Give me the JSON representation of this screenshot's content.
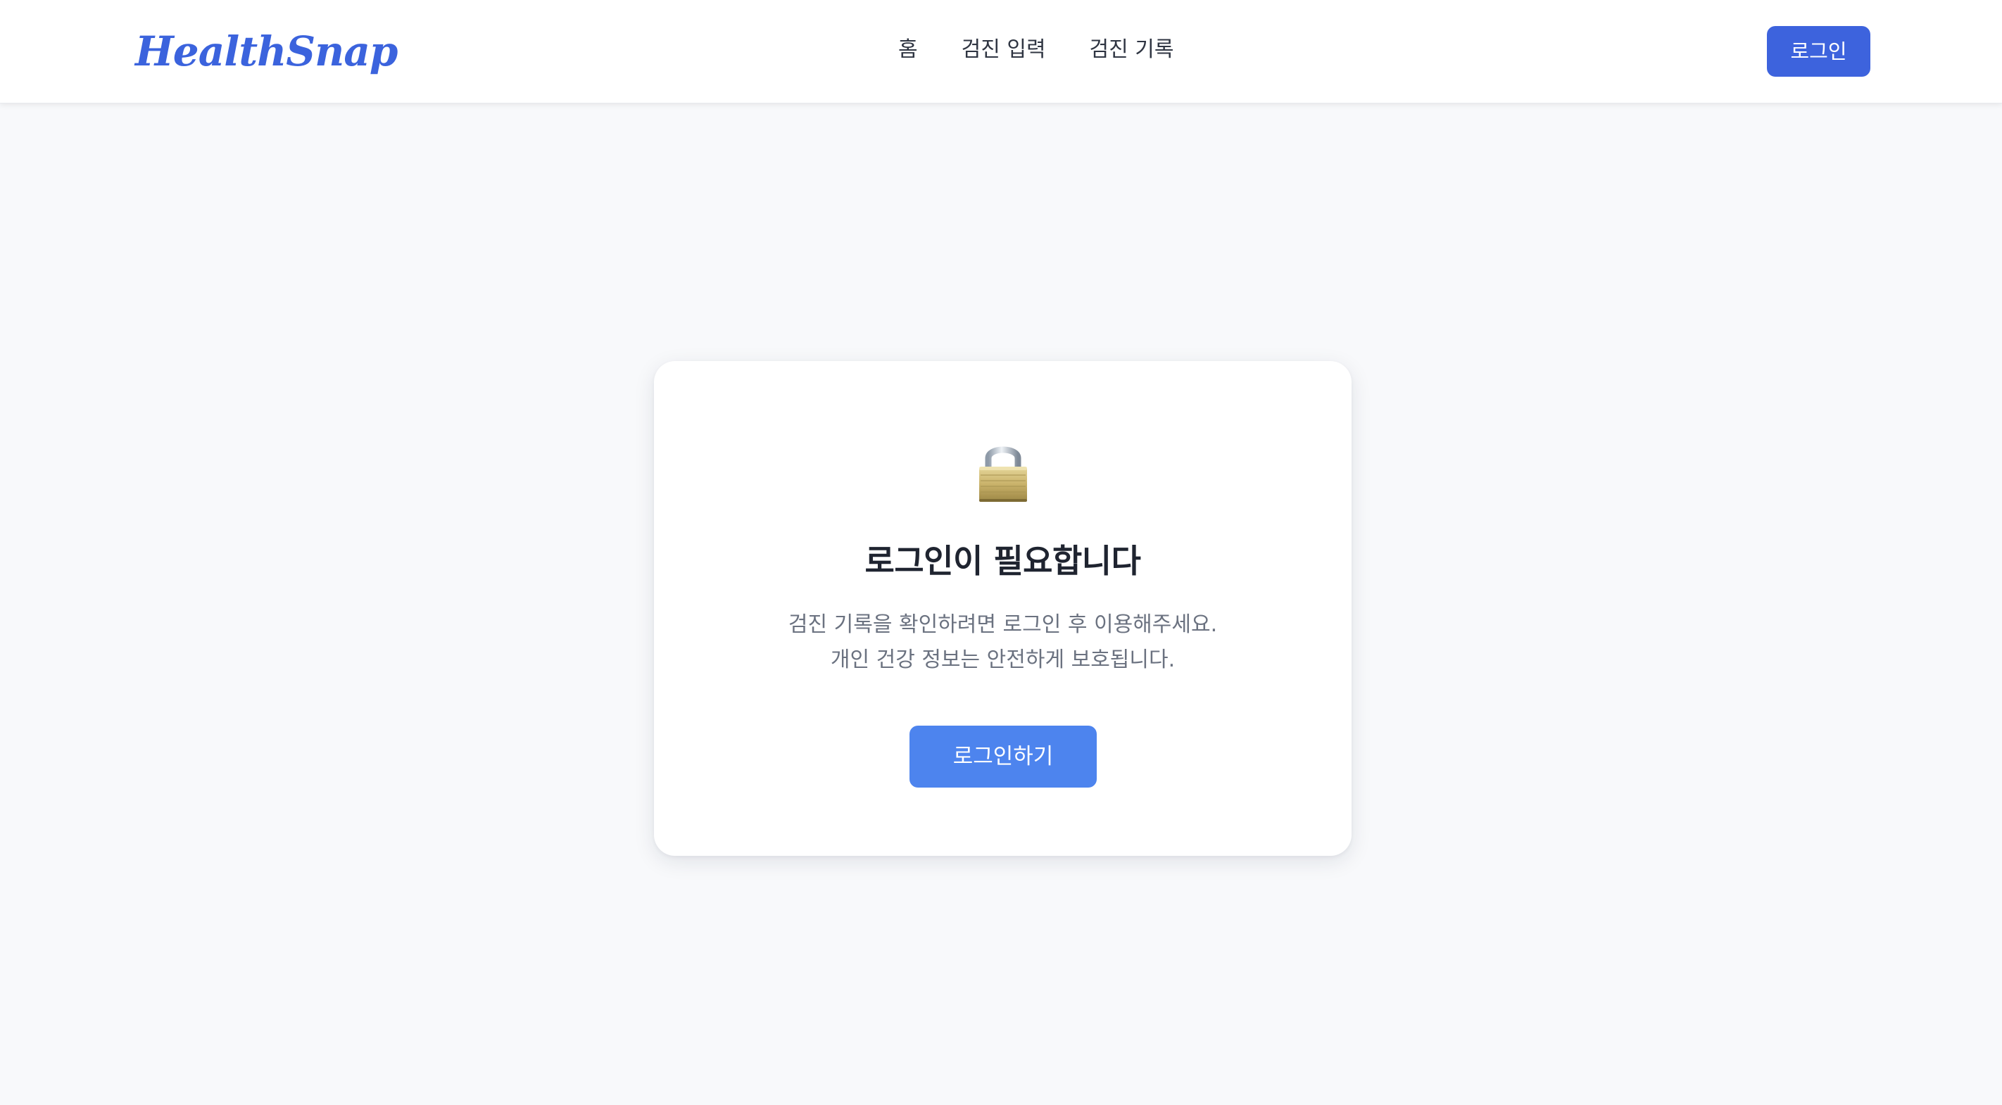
{
  "header": {
    "logo_text": "HealthSnap",
    "nav": [
      {
        "label": "홈"
      },
      {
        "label": "검진 입력"
      },
      {
        "label": "검진 기록"
      }
    ],
    "login_label": "로그인"
  },
  "auth_card": {
    "icon": "lock-icon",
    "title": "로그인이 필요합니다",
    "description_lines": [
      "검진 기록을 확인하려면 로그인 후 이용해주세요.",
      "개인 건강 정보는 안전하게 보호됩니다."
    ],
    "button_label": "로그인하기"
  },
  "colors": {
    "brand": "#3b63dd",
    "primary_button": "#3d63dd",
    "card_button": "#4d84ee",
    "page_background": "#f8f9fb",
    "muted_text": "#6b7280"
  }
}
